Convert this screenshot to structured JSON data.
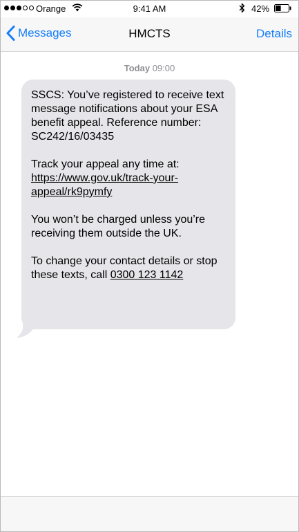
{
  "status_bar": {
    "signal_filled": 3,
    "signal_total": 5,
    "carrier": "Orange",
    "time": "9:41 AM",
    "battery_percent": "42%",
    "battery_level": 0.42
  },
  "nav": {
    "back_label": "Messages",
    "title": "HMCTS",
    "details_label": "Details"
  },
  "timestamp": {
    "day": "Today",
    "time": "09:00"
  },
  "message": {
    "p1": "SSCS: You’ve registered to receive text message notifications about your ESA benefit appeal. Reference number: SC242/16/03435",
    "p2_prefix": "Track your appeal any time at: ",
    "p2_link": "https://www.gov.uk/track-your-appeal/rk9pymfy",
    "p3": "You won’t be charged unless you’re receiving them outside the UK.",
    "p4_prefix": "To change your contact details or stop these texts, call ",
    "p4_phone": "0300 123 1142"
  },
  "colors": {
    "accent": "#157efb",
    "bubble": "#e5e5ea",
    "timestamp": "#8e8e93"
  },
  "icons": {
    "back": "chevron-left-icon",
    "wifi": "wifi-icon",
    "bluetooth": "bluetooth-icon",
    "battery": "battery-icon"
  }
}
